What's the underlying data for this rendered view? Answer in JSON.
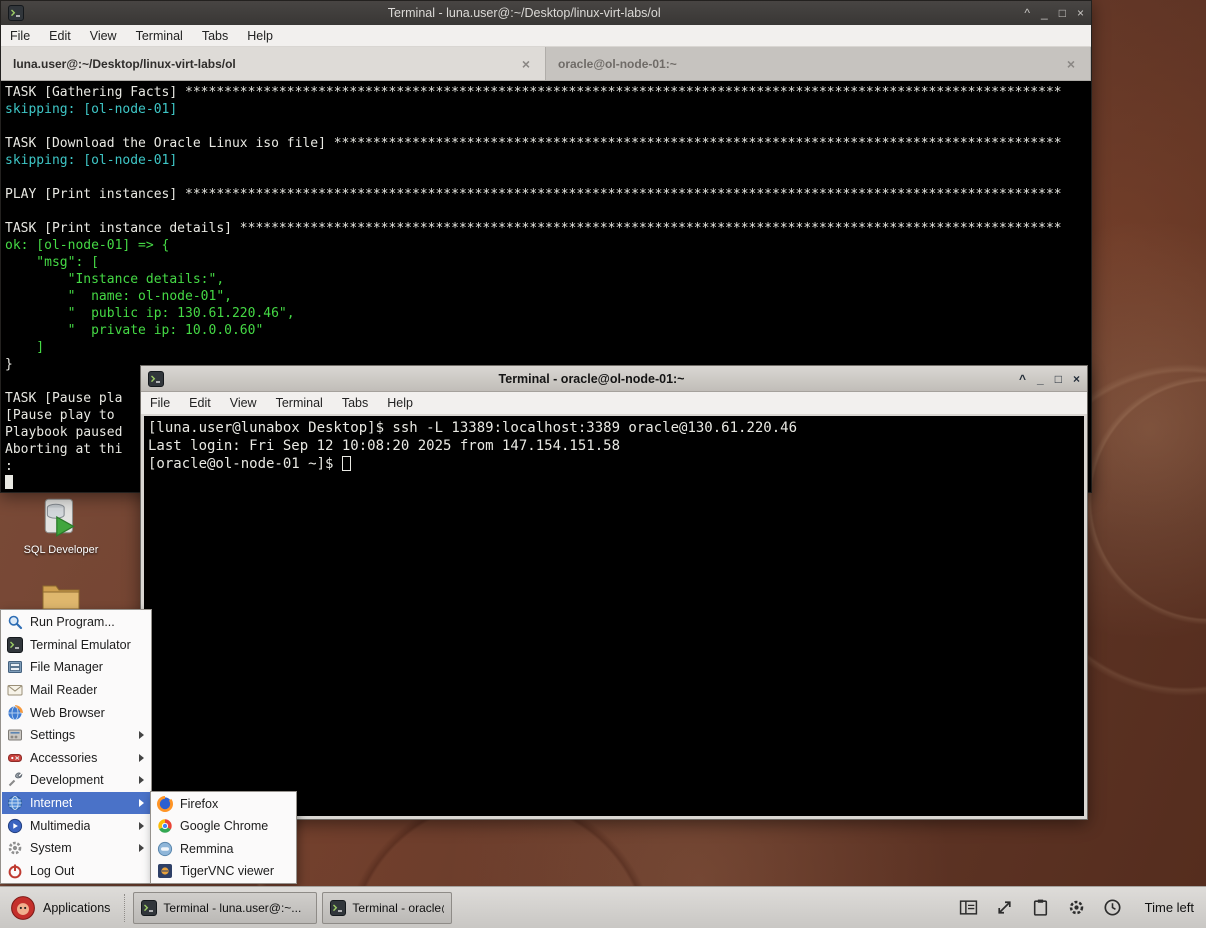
{
  "desktop": {
    "icons": [
      {
        "label": "SQL Developer",
        "icon": "sql-developer-icon"
      },
      {
        "label": "",
        "icon": "folder-icon"
      }
    ]
  },
  "window_controls": [
    "rollup",
    "minimize",
    "maximize",
    "close"
  ],
  "window1": {
    "icon": "terminal-icon",
    "title": "Terminal - luna.user@:~/Desktop/linux-virt-labs/ol",
    "menu": [
      "File",
      "Edit",
      "View",
      "Terminal",
      "Tabs",
      "Help"
    ],
    "tabs": [
      {
        "label": "luna.user@:~/Desktop/linux-virt-labs/ol",
        "active": true
      },
      {
        "label": "oracle@ol-node-01:~",
        "active": false
      }
    ],
    "terminal_lines": [
      {
        "text": "TASK [Gathering Facts] ",
        "pad_to": 135,
        "pad_char": "*",
        "color": "white"
      },
      {
        "text": "skipping: [ol-node-01]",
        "color": "cyan"
      },
      {
        "text": ""
      },
      {
        "text": "TASK [Download the Oracle Linux iso file] ",
        "pad_to": 135,
        "pad_char": "*",
        "color": "white"
      },
      {
        "text": "skipping: [ol-node-01]",
        "color": "cyan"
      },
      {
        "text": ""
      },
      {
        "text": "PLAY [Print instances] ",
        "pad_to": 135,
        "pad_char": "*",
        "color": "white"
      },
      {
        "text": ""
      },
      {
        "text": "TASK [Print instance details] ",
        "pad_to": 135,
        "pad_char": "*",
        "color": "white"
      },
      {
        "text": "ok: [ol-node-01] => {",
        "color": "green"
      },
      {
        "text": "    \"msg\": [",
        "color": "green"
      },
      {
        "text": "        \"Instance details:\",",
        "color": "green"
      },
      {
        "text": "        \"  name: ol-node-01\",",
        "color": "green"
      },
      {
        "text": "        \"  public ip: 130.61.220.46\",",
        "color": "green"
      },
      {
        "text": "        \"  private ip: 10.0.0.60\"",
        "color": "green"
      },
      {
        "text": "    ]",
        "color": "green"
      },
      {
        "text": "}",
        "color": "white"
      },
      {
        "text": ""
      },
      {
        "text": "TASK [Pause pla",
        "color": "white"
      },
      {
        "text": "[Pause play to",
        "color": "white"
      },
      {
        "text": "Playbook paused",
        "color": "white"
      },
      {
        "text": "Aborting at thi",
        "color": "white"
      },
      {
        "text": ":",
        "color": "white"
      },
      {
        "text": "",
        "cursor": "block"
      }
    ]
  },
  "window2": {
    "icon": "terminal-icon",
    "title": "Terminal - oracle@ol-node-01:~",
    "menu": [
      "File",
      "Edit",
      "View",
      "Terminal",
      "Tabs",
      "Help"
    ],
    "terminal_lines": [
      {
        "text": "[luna.user@lunabox Desktop]$ ssh -L 13389:localhost:3389 oracle@130.61.220.46"
      },
      {
        "text": "Last login: Fri Sep 12 10:08:20 2025 from 147.154.151.58"
      },
      {
        "text": "[oracle@ol-node-01 ~]$ ",
        "cursor": "hollow"
      }
    ]
  },
  "apps_menu": {
    "items": [
      {
        "label": "Run Program...",
        "icon": "magnifier-icon"
      },
      {
        "label": "Terminal Emulator",
        "icon": "terminal-icon"
      },
      {
        "label": "File Manager",
        "icon": "file-manager-icon"
      },
      {
        "label": "Mail Reader",
        "icon": "mail-icon"
      },
      {
        "label": "Web Browser",
        "icon": "web-browser-icon"
      },
      {
        "label": "Settings",
        "icon": "settings-icon",
        "submenu": true
      },
      {
        "label": "Accessories",
        "icon": "accessories-icon",
        "submenu": true
      },
      {
        "label": "Development",
        "icon": "development-icon",
        "submenu": true
      },
      {
        "label": "Internet",
        "icon": "internet-icon",
        "submenu": true,
        "highlighted": true
      },
      {
        "label": "Multimedia",
        "icon": "multimedia-icon",
        "submenu": true
      },
      {
        "label": "System",
        "icon": "system-icon",
        "submenu": true
      },
      {
        "label": "Log Out",
        "icon": "logout-icon"
      }
    ]
  },
  "internet_submenu": {
    "items": [
      {
        "label": "Firefox",
        "icon": "firefox-icon"
      },
      {
        "label": "Google Chrome",
        "icon": "chrome-icon"
      },
      {
        "label": "Remmina",
        "icon": "remmina-icon"
      },
      {
        "label": "TigerVNC viewer",
        "icon": "tigervnc-icon"
      }
    ]
  },
  "taskbar": {
    "applications_label": "Applications",
    "applications_icon": "applications-icon",
    "tasks": [
      {
        "label": "Terminal - luna.user@:~...",
        "icon": "terminal-icon"
      },
      {
        "label": "Terminal - oracle@ol-no...",
        "icon": "terminal-icon"
      }
    ],
    "tray_icons": [
      "layout-icon",
      "resize-icon",
      "clipboard-icon",
      "gear-icon",
      "clock-icon"
    ],
    "time_left_label": "Time left"
  },
  "colors": {
    "terminal_green": "#45d945",
    "terminal_cyan": "#3ec6c6",
    "terminal_fg": "#e9e9e3",
    "menu_highlight": "#4a72c8"
  }
}
